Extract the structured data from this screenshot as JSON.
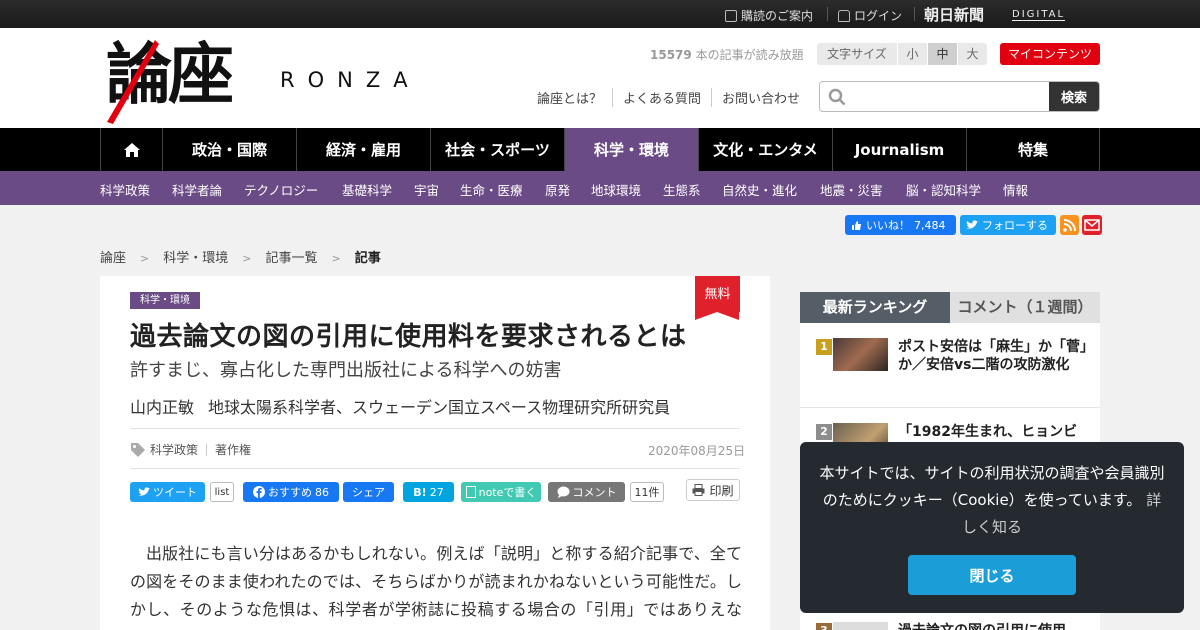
{
  "topbar": {
    "subscribe": "購読のご案内",
    "login": "ログイン",
    "brand": "朝日新聞",
    "brand_digital": "DIGITAL"
  },
  "header": {
    "logo_kanji": "論座",
    "logo_roman": "RONZA",
    "article_count": "15579",
    "article_count_suffix": " 本の記事が読み放題",
    "font_size_label": "文字サイズ",
    "font_sizes": [
      "小",
      "中",
      "大"
    ],
    "font_size_selected": "中",
    "my_contents": "マイコンテンツ",
    "links": [
      "論座とは？",
      "よくある質問",
      "お問い合わせ"
    ],
    "search_placeholder": "",
    "search_button": "検索"
  },
  "nav": {
    "items": [
      "政治・国際",
      "経済・雇用",
      "社会・スポーツ",
      "科学・環境",
      "文化・エンタメ",
      "Journalism",
      "特集"
    ],
    "active": "科学・環境"
  },
  "subnav": [
    "科学政策",
    "科学者論",
    "テクノロジー",
    "基礎科学",
    "宇宙",
    "生命・医療",
    "原発",
    "地球環境",
    "生態系",
    "自然史・進化",
    "地震・災害",
    "脳・認知科学",
    "情報"
  ],
  "social": {
    "facebook_label": "いいね！",
    "facebook_count": "7,484",
    "twitter_label": "フォローする"
  },
  "breadcrumb": [
    "論座",
    "科学・環境",
    "記事一覧",
    "記事"
  ],
  "article": {
    "category_tag": "科学・環境",
    "free_badge": "無料",
    "title": "過去論文の図の引用に使用料を要求されるとは",
    "subtitle": "許すまじ、寡占化した専門出版社による科学への妨害",
    "author_name": "山内正敏",
    "author_title": "地球太陽系科学者、スウェーデン国立スペース物理研究所研究員",
    "keywords": [
      "科学政策",
      "著作権"
    ],
    "date": "2020年08月25日",
    "share": {
      "tweet": "ツイート",
      "list": "list",
      "fb_recommend": "おすすめ",
      "fb_count": "86",
      "fb_share": "シェア",
      "hatena": "B!",
      "hatena_count": "27",
      "note": "noteで書く",
      "comment": "コメント",
      "comment_count": "11件",
      "print": "印刷"
    },
    "body": "出版社にも言い分はあるかもしれない。例えば「説明」と称する紹介記事で、全ての図をそのまま使われたのでは、そちらばかりが読まれかねないという可能性だ。しかし、そのような危惧は、科学者が学術誌に投稿する場合の「引用」ではありえない。"
  },
  "ranking": {
    "tab_active": "最新ランキング",
    "tab_other": "コメント（１週間）",
    "items": [
      {
        "rank": "1",
        "text": "ポスト安倍は「麻生」か「菅」か／安倍vs二階の攻防激化"
      },
      {
        "rank": "2",
        "text": "「1982年生まれ、ヒョンビ"
      },
      {
        "rank": "3",
        "text": "過去論文の図の引用に使用"
      }
    ],
    "rank_colors": [
      "#c8a01e",
      "#8d8d8d",
      "#9a6b3a"
    ]
  },
  "cookie": {
    "message": "本サイトでは、サイトの利用状況の調査や会員識別のためにクッキー（Cookie）を使っています。",
    "more_link": "詳しく知る",
    "close_button": "閉じる"
  }
}
